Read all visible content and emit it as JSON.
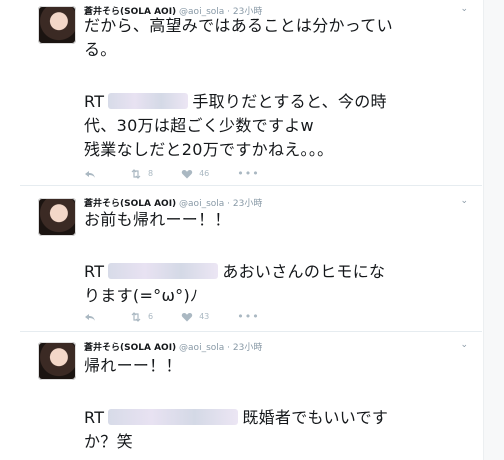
{
  "tweets": [
    {
      "name": "蒼井そら(SOLA AOI)",
      "handle": "@aoi_sola",
      "time": "23小時",
      "lines": [
        "だから、高望みではあることは分かってい",
        "る。"
      ],
      "rt_prefix": "RT",
      "rt_lines": [
        "手取りだとすると、今の時",
        "代、30万は超ごく少数ですよw",
        "残業なしだと20万ですかねえ。。。"
      ],
      "retweets": "8",
      "likes": "46"
    },
    {
      "name": "蒼井そら(SOLA AOI)",
      "handle": "@aoi_sola",
      "time": "23小時",
      "lines": [
        "お前も帰れーー！！"
      ],
      "rt_prefix": "RT",
      "rt_lines": [
        "あおいさんのヒモにな",
        "ります(=°ω°)ﾉ"
      ],
      "retweets": "6",
      "likes": "43"
    },
    {
      "name": "蒼井そら(SOLA AOI)",
      "handle": "@aoi_sola",
      "time": "23小時",
      "lines": [
        "帰れーー！！"
      ],
      "rt_prefix": "RT",
      "rt_lines": [
        "既婚者でもいいです",
        "か？笑"
      ],
      "retweets": "",
      "likes": ""
    }
  ],
  "icons": {
    "reply": "reply-icon",
    "retweet": "retweet-icon",
    "like": "heart-icon",
    "more": "more-icon",
    "menu": "chevron-down-icon"
  },
  "separator": "·",
  "more_glyph": "•••",
  "chevron_glyph": "⌄"
}
